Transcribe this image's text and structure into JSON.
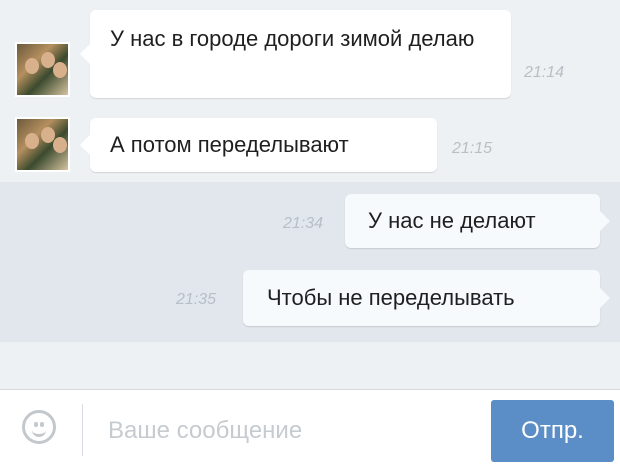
{
  "messages": [
    {
      "direction": "incoming",
      "text": "У нас в городе дороги зимой делаю",
      "time": "21:14"
    },
    {
      "direction": "incoming",
      "text": "А потом переделывают",
      "time": "21:15"
    },
    {
      "direction": "outgoing",
      "text": "У нас не делают",
      "time": "21:34"
    },
    {
      "direction": "outgoing",
      "text": "Чтобы не переделывать",
      "time": "21:35"
    }
  ],
  "composer": {
    "placeholder": "Ваше сообщение",
    "value": "",
    "send_label": "Отпр.",
    "emoji_icon": "smile-icon"
  },
  "colors": {
    "chat_background": "#eef1f3",
    "outgoing_band": "#e1e7ec",
    "send_button": "#5b8ec6",
    "timestamp": "#b7bfc7"
  }
}
